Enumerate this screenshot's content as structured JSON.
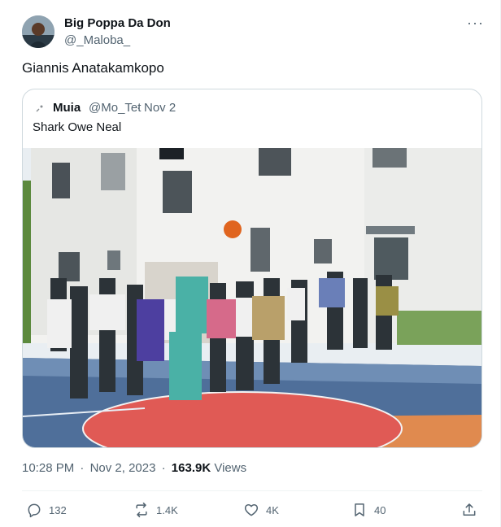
{
  "author": {
    "name": "Big Poppa Da Don",
    "handle": "@_Maloba_"
  },
  "tweet": {
    "text": "Giannis Anatakamkopo"
  },
  "quoted": {
    "name": "Muia",
    "handle": "@Mo_Tet",
    "separator": "·",
    "date": "Nov 2",
    "text": "Shark Owe Neal"
  },
  "meta": {
    "time": "10:28 PM",
    "separator": "·",
    "date": "Nov 2, 2023",
    "separator2": "·",
    "views_count": "163.9K",
    "views_label": "Views"
  },
  "actions": {
    "replies": "132",
    "reposts": "1.4K",
    "likes": "4K",
    "bookmarks": "40"
  },
  "icons": {
    "more": "more-icon",
    "reply": "reply-icon",
    "repost": "repost-icon",
    "like": "heart-icon",
    "bookmark": "bookmark-icon",
    "share": "share-icon"
  },
  "colors": {
    "text": "#0f1419",
    "secondary": "#536471",
    "border": "#cfd9de"
  }
}
